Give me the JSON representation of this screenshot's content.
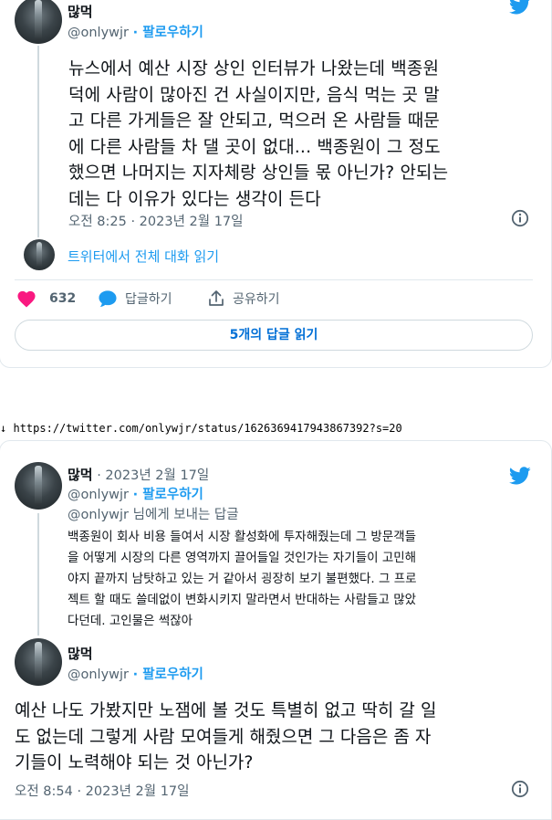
{
  "tweet1": {
    "name": "많먹",
    "handle": "@onlywjr",
    "follow": "· 팔로우하기",
    "text_lines": [
      "뉴스에서 예산 시장 상인 인터뷰가 나왔는데 백종원",
      "덕에 사람이 많아진 건 사실이지만, 음식 먹는 곳 말",
      "고 다른 가게들은 잘 안되고, 먹으러 온 사람들 때문",
      "에 다른 사람들 차 댈 곳이 없대... 백종원이 그 정도",
      "했으면 나머지는 지자체랑 상인들 몫 아닌가? 안되는",
      "데는 다 이유가 있다는 생각이 든다"
    ],
    "timestamp": "오전 8:25 · 2023년 2월 17일",
    "read_thread": "트위터에서 전체 대화 읽기",
    "likes": "632",
    "reply_label": "답글하기",
    "share_label": "공유하기",
    "read_replies": "5개의 답글 읽기"
  },
  "url_line": {
    "arrow": "↓",
    "url": "https://twitter.com/onlywjr/status/1626369417943867392?s=20"
  },
  "tweet2": {
    "name": "많먹",
    "date": "· 2023년 2월 17일",
    "handle": "@onlywjr",
    "follow": "· 팔로우하기",
    "reply_to_handle": "@onlywjr",
    "reply_to_suffix": " 님에게 보내는 답글",
    "text_lines": [
      "백종원이 회사 비용 들여서 시장 활성화에 투자해줬는데 그 방문객들",
      "을 어떻게 시장의 다른 영역까지 끌어들일 것인가는 자기들이 고민해",
      "야지 끝까지 남탓하고 있는 거 같아서 굉장히 보기 불편했다. 그 프로",
      "젝트 할 때도 쓸데없이 변화시키지 말라면서 반대하는 사람들고 많았",
      "다던데. 고인물은 썩잖아"
    ]
  },
  "tweet3": {
    "name": "많먹",
    "handle": "@onlywjr",
    "follow": "· 팔로우하기",
    "text_lines": [
      "예산 나도 가봤지만 노잼에 볼 것도 특별히 없고 딱히 갈 일",
      "도 없는데 그렇게 사람 모여들게 해줬으면 그 다음은 좀 자",
      "기들이 노력해야 되는 것 아닌가?"
    ],
    "timestamp": "오전 8:54 · 2023년 2월 17일"
  },
  "colors": {
    "twitter_blue": "#1d9bf0",
    "heart_red": "#f91880",
    "muted_gray": "#536471",
    "link_blue": "#006fd6"
  },
  "icons": [
    "twitter-bird-icon",
    "heart-icon",
    "reply-bubble-icon",
    "share-icon",
    "info-icon",
    "down-arrow-icon"
  ]
}
